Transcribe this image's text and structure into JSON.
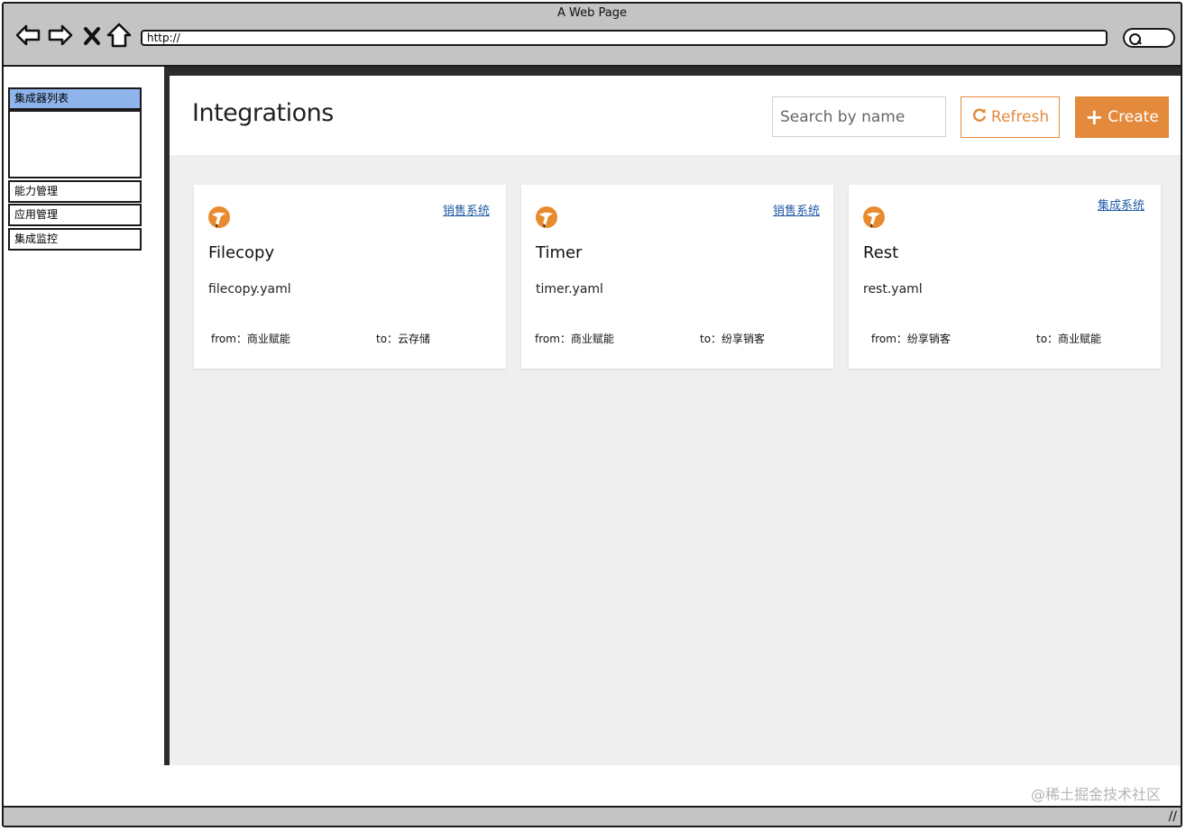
{
  "window": {
    "title": "A Web Page",
    "address": "http://"
  },
  "sidebar": {
    "items": [
      {
        "label": "集成器列表",
        "active": true
      },
      {
        "label": "能力管理",
        "active": false
      },
      {
        "label": "应用管理",
        "active": false
      },
      {
        "label": "集成监控",
        "active": false
      }
    ]
  },
  "main": {
    "title": "Integrations",
    "search_placeholder": "Search by name",
    "refresh_label": "Refresh",
    "create_label": "Create",
    "accent_color": "#e38a3c",
    "cards": [
      {
        "name": "Filecopy",
        "file": "filecopy.yaml",
        "tag": "销售系统",
        "from": "from：商业赋能",
        "to": "to：云存储",
        "icon": "camel-logo-icon"
      },
      {
        "name": "Timer",
        "file": "timer.yaml",
        "tag": "销售系统",
        "from": "from：商业赋能",
        "to": "to：纷享销客",
        "icon": "camel-logo-icon"
      },
      {
        "name": "Rest",
        "file": "rest.yaml",
        "tag": "集成系统",
        "from": "from：纷享销客",
        "to": "to：商业赋能",
        "icon": "camel-logo-icon"
      }
    ]
  },
  "watermark": "@稀土掘金技术社区"
}
